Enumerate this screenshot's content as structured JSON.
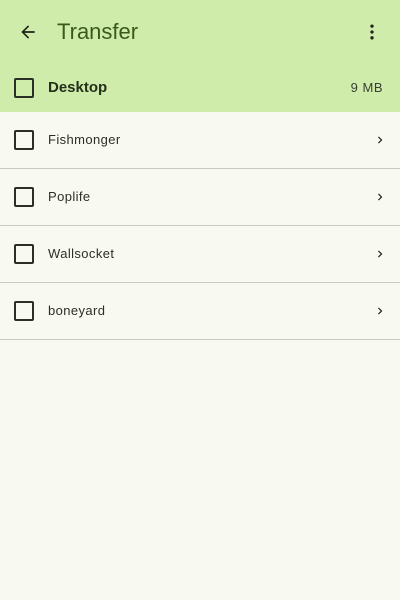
{
  "app": {
    "title": "Transfer"
  },
  "colors": {
    "topbar_bg": "#cfecab",
    "page_bg": "#f8f9f0",
    "title_color": "#3a5a1c",
    "divider": "#c8cbc0"
  },
  "icons": {
    "back": "arrow-back-icon",
    "menu": "more-vertical-icon",
    "row_action": "chevron-right-icon"
  },
  "header_row": {
    "label": "Desktop",
    "size": "9 MB",
    "checked": false
  },
  "items": [
    {
      "label": "Fishmonger",
      "checked": false
    },
    {
      "label": "Poplife",
      "checked": false
    },
    {
      "label": "Wallsocket",
      "checked": false
    },
    {
      "label": "boneyard",
      "checked": false
    }
  ]
}
